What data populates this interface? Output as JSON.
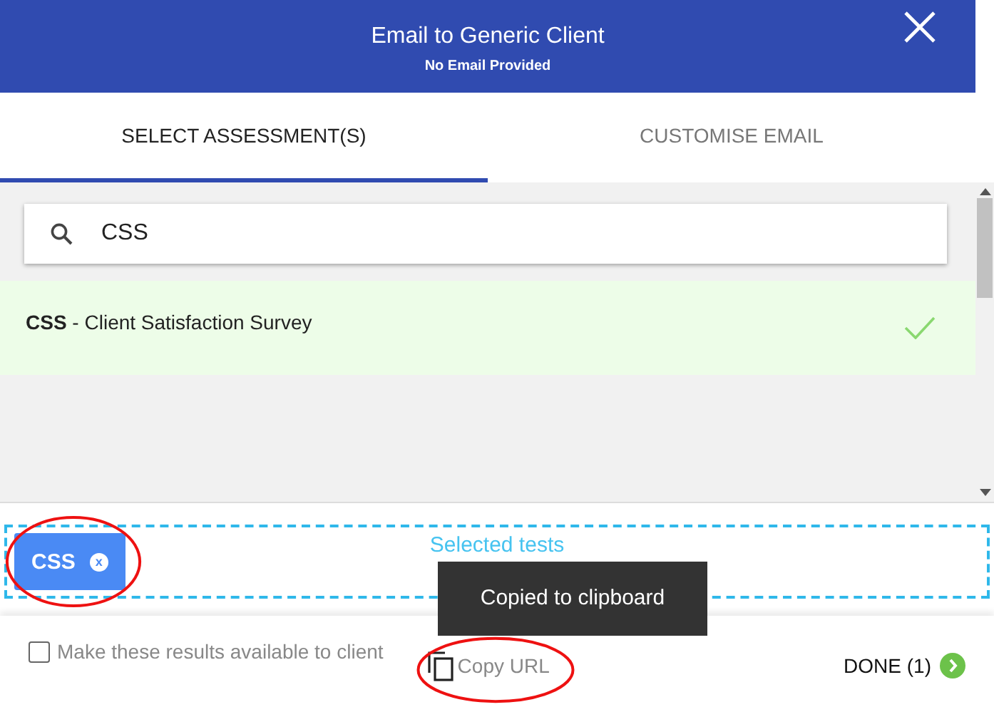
{
  "header": {
    "title": "Email to Generic Client",
    "subtitle": "No Email Provided"
  },
  "tabs": [
    {
      "label": "SELECT ASSESSMENT(S)",
      "selected": true
    },
    {
      "label": "CUSTOMISE EMAIL",
      "selected": false
    }
  ],
  "search": {
    "value": "CSS"
  },
  "results": [
    {
      "name": "**CSS** - Client Satisfaction Survey",
      "selected": true
    }
  ],
  "selected_tests": {
    "label": "Selected tests",
    "chips": [
      {
        "label": "CSS",
        "remove": "x"
      }
    ]
  },
  "tooltip": "Copied to clipboard",
  "footer": {
    "checkbox": {
      "label": "Make these results available to client",
      "checked": false
    },
    "copy_url": "Copy URL",
    "done": "DONE (1)"
  }
}
